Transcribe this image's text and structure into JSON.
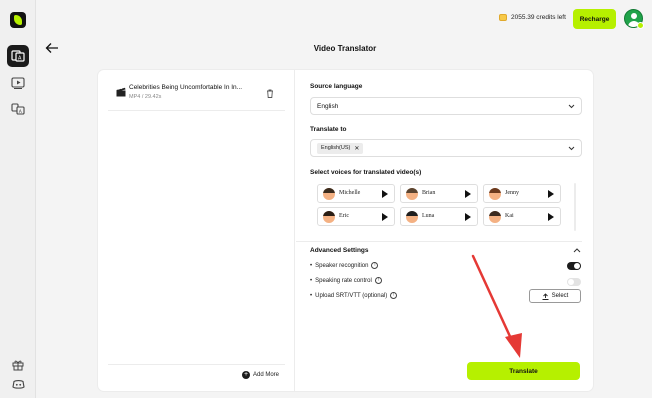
{
  "colors": {
    "accent": "#b6f000",
    "annotation": "#e53935",
    "dark": "#1b1b1b"
  },
  "sidebar": {
    "items": [
      {
        "icon": "translate-icon",
        "active": true
      },
      {
        "icon": "video-play-icon",
        "active": false
      },
      {
        "icon": "voice-translate-icon",
        "active": false
      },
      {
        "icon": "gift-icon",
        "active": false
      },
      {
        "icon": "discord-icon",
        "active": false
      }
    ]
  },
  "header": {
    "credits": "2055.39 credits left",
    "recharge_label": "Recharge",
    "page_title": "Video Translator"
  },
  "file": {
    "name": "Celebrities Being Uncomfortable In In...",
    "meta": "MP4 / 29.42s"
  },
  "add_more_label": "Add More",
  "source": {
    "label": "Source language",
    "value": "English"
  },
  "target": {
    "label": "Translate to",
    "chip": "English(US)"
  },
  "voices": {
    "label": "Select voices for translated video(s)",
    "items": [
      "Michelle",
      "Brian",
      "Jenny",
      "Eric",
      "Luna",
      "Kai"
    ]
  },
  "advanced": {
    "label": "Advanced Settings",
    "speaker_recognition": {
      "label": "Speaker recognition",
      "on": true
    },
    "speaking_rate": {
      "label": "Speaking rate control",
      "on": false
    },
    "upload": {
      "label": "Upload SRT/VTT (optional)",
      "button": "Select"
    }
  },
  "translate_label": "Translate"
}
